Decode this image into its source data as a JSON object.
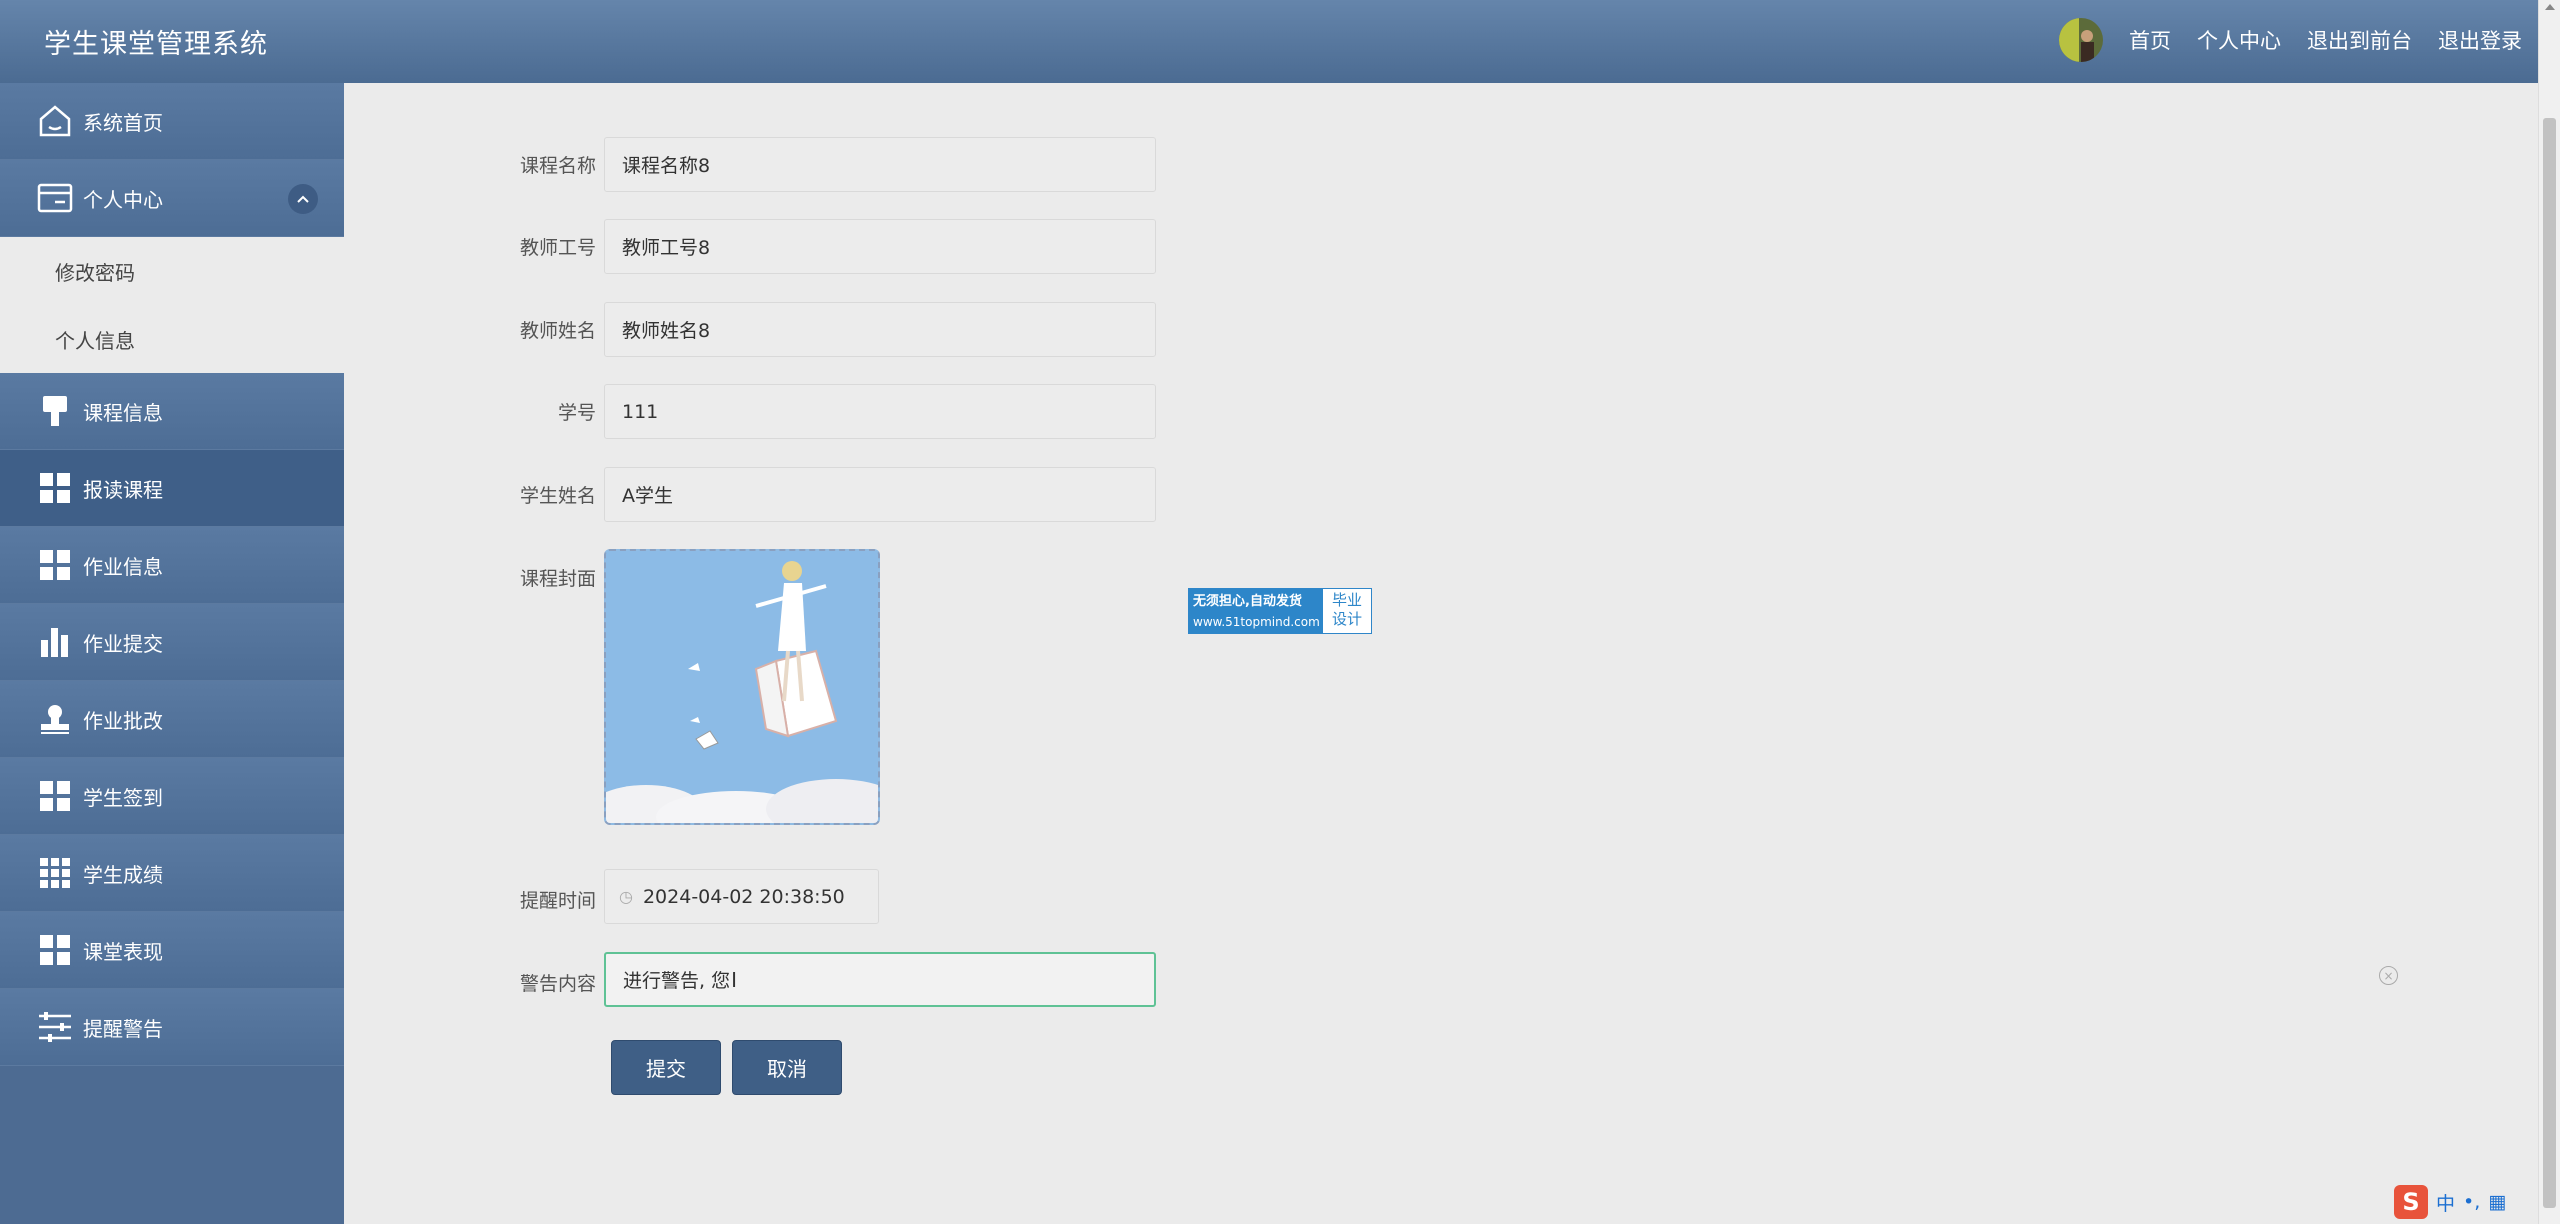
{
  "app": {
    "title": "学生课堂管理系统"
  },
  "header": {
    "nav": [
      "首页",
      "个人中心",
      "退出到前台",
      "退出登录"
    ]
  },
  "sidebar": {
    "items": [
      {
        "label": "系统首页",
        "icon": "home-icon"
      },
      {
        "label": "个人中心",
        "icon": "card-icon",
        "expanded": true,
        "children": [
          "修改密码",
          "个人信息"
        ]
      },
      {
        "label": "课程信息",
        "icon": "brush-icon"
      },
      {
        "label": "报读课程",
        "icon": "grid-icon",
        "active": true
      },
      {
        "label": "作业信息",
        "icon": "grid-icon"
      },
      {
        "label": "作业提交",
        "icon": "bar-chart-icon"
      },
      {
        "label": "作业批改",
        "icon": "stamp-icon"
      },
      {
        "label": "学生签到",
        "icon": "grid-icon"
      },
      {
        "label": "学生成绩",
        "icon": "grid9-icon"
      },
      {
        "label": "课堂表现",
        "icon": "grid-icon"
      },
      {
        "label": "提醒警告",
        "icon": "sliders-icon"
      }
    ]
  },
  "form": {
    "course_name": {
      "label": "课程名称",
      "value": "课程名称8"
    },
    "teacher_id": {
      "label": "教师工号",
      "value": "教师工号8"
    },
    "teacher_name": {
      "label": "教师姓名",
      "value": "教师姓名8"
    },
    "student_id": {
      "label": "学号",
      "value": "111"
    },
    "student_name": {
      "label": "学生姓名",
      "value": "A学生"
    },
    "cover": {
      "label": "课程封面"
    },
    "remind_time": {
      "label": "提醒时间",
      "value": "2024-04-02 20:38:50"
    },
    "warning": {
      "label": "警告内容",
      "value": "进行警告, 您"
    },
    "submit_label": "提交",
    "cancel_label": "取消"
  },
  "watermark": {
    "line1": "无须担心,自动发货",
    "line2": "www.51topmind.com",
    "right1": "毕业",
    "right2": "设计"
  },
  "ime": {
    "mode": "中",
    "punct": "•,"
  },
  "colors": {
    "header": "#5677a0",
    "sidebar": "#4d6b92",
    "active_menu": "#3f5f88",
    "button": "#3f5f86",
    "focus_border": "#5fc295"
  }
}
